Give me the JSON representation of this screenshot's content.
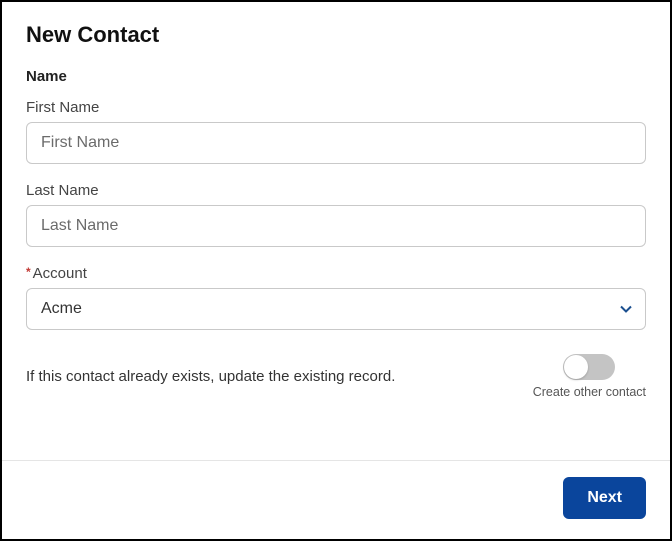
{
  "title": "New Contact",
  "section_name": "Name",
  "fields": {
    "first_name": {
      "label": "First Name",
      "placeholder": "First Name",
      "value": ""
    },
    "last_name": {
      "label": "Last Name",
      "placeholder": "Last Name",
      "value": ""
    },
    "account": {
      "label": "Account",
      "required": true,
      "selected": "Acme"
    }
  },
  "helper_text": "If this contact already exists, update the existing record.",
  "toggle": {
    "label": "Create other contact",
    "on": false
  },
  "footer": {
    "next": "Next"
  }
}
